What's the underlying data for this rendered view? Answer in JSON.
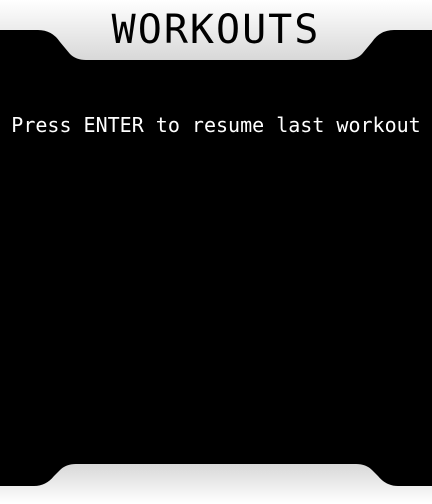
{
  "screen": {
    "title": "WORKOUTS",
    "message": "Press ENTER to resume last workout"
  },
  "colors": {
    "background": "#000000",
    "bar": "#eeeeee",
    "text": "#ffffff",
    "title_text": "#000000"
  }
}
